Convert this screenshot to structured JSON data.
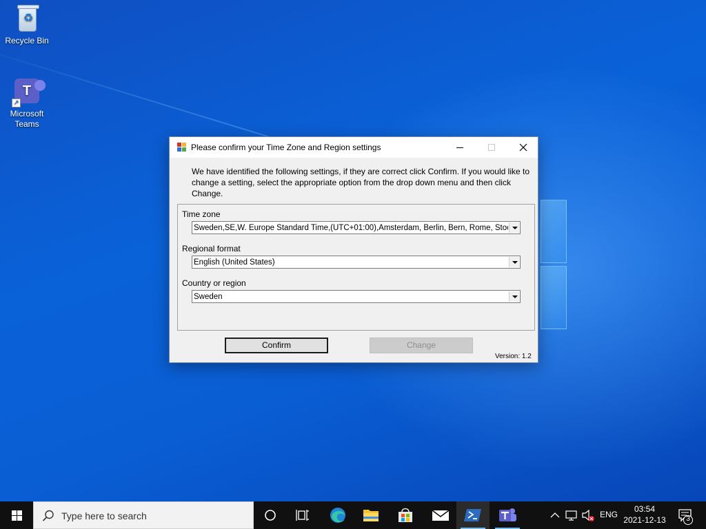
{
  "desktop": {
    "icons": [
      {
        "label": "Recycle Bin",
        "icon": "recycle-bin-icon"
      },
      {
        "label": "Microsoft Teams",
        "icon": "teams-icon"
      }
    ]
  },
  "dialog": {
    "title": "Please confirm your Time Zone and Region settings",
    "intro": "We have identified the following settings, if they are correct click Confirm. If you would like to change a setting, select the appropriate option from the drop down menu and then click Change.",
    "fields": {
      "time_zone": {
        "label": "Time zone",
        "value": "Sweden,SE,W. Europe Standard Time,(UTC+01:00),Amsterdam, Berlin, Bern, Rome, Stockholm, Vienna"
      },
      "regional_format": {
        "label": "Regional format",
        "value": "English (United States)"
      },
      "country": {
        "label": "Country or region",
        "value": "Sweden"
      }
    },
    "buttons": {
      "confirm": "Confirm",
      "change": "Change"
    },
    "version": "Version: 1.2"
  },
  "taskbar": {
    "search_placeholder": "Type here to search",
    "language": "ENG",
    "time": "03:54",
    "date": "2021-12-13",
    "notification_count": "3",
    "pinned": [
      "task-view-icon",
      "edge-icon",
      "file-explorer-icon",
      "store-icon",
      "mail-icon",
      "powershell-icon",
      "teams-icon"
    ]
  },
  "colors": {
    "taskbar": "#101010",
    "accent": "#76b9ed",
    "desktop": "#0a5ed4"
  }
}
